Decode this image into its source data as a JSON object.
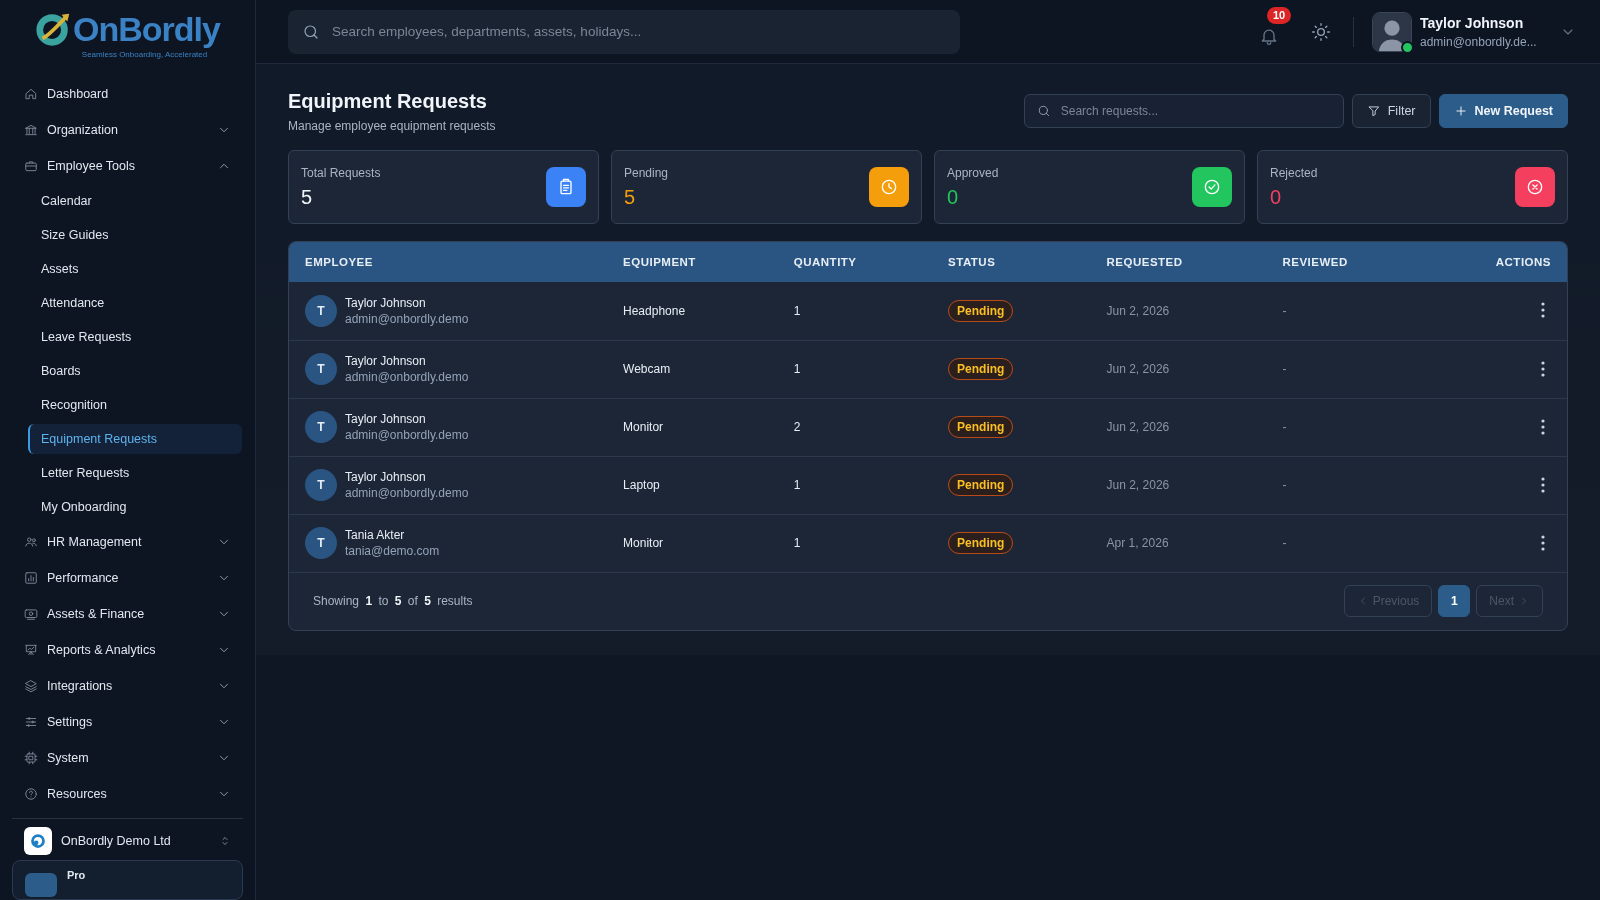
{
  "sidebar": {
    "logo": {
      "name": "OnBordly",
      "tagline": "Seamless Onboarding, Accelerated"
    },
    "items": [
      {
        "label": "Dashboard",
        "kind": "link"
      },
      {
        "label": "Organization",
        "kind": "group",
        "expanded": false
      },
      {
        "label": "Employee Tools",
        "kind": "group",
        "expanded": true,
        "children": [
          {
            "label": "Calendar",
            "selected": false
          },
          {
            "label": "Size Guides",
            "selected": false
          },
          {
            "label": "Assets",
            "selected": false
          },
          {
            "label": "Attendance",
            "selected": false
          },
          {
            "label": "Leave Requests",
            "selected": false
          },
          {
            "label": "Boards",
            "selected": false
          },
          {
            "label": "Recognition",
            "selected": false
          },
          {
            "label": "Equipment Requests",
            "selected": true
          },
          {
            "label": "Letter Requests",
            "selected": false
          },
          {
            "label": "My Onboarding",
            "selected": false
          }
        ]
      },
      {
        "label": "HR Management",
        "kind": "group",
        "expanded": false
      },
      {
        "label": "Performance",
        "kind": "group",
        "expanded": false
      },
      {
        "label": "Assets & Finance",
        "kind": "group",
        "expanded": false
      },
      {
        "label": "Reports & Analytics",
        "kind": "group",
        "expanded": false
      },
      {
        "label": "Integrations",
        "kind": "group",
        "expanded": false
      },
      {
        "label": "Settings",
        "kind": "group",
        "expanded": false
      },
      {
        "label": "System",
        "kind": "group",
        "expanded": false
      },
      {
        "label": "Resources",
        "kind": "group",
        "expanded": false
      }
    ],
    "workspace": {
      "name": "OnBordly Demo Ltd"
    },
    "plan": {
      "label": "Pro"
    }
  },
  "topbar": {
    "search": {
      "placeholder": "Search employees, departments, assets, holidays..."
    },
    "notifications": {
      "count": "10"
    },
    "user": {
      "name": "Taylor Johnson",
      "email": "admin@onbordly.de...",
      "online": true
    }
  },
  "page": {
    "title": "Equipment Requests",
    "subtitle": "Manage employee equipment requests",
    "search": {
      "placeholder": "Search requests..."
    },
    "buttons": [
      {
        "label": "Filter",
        "kind": "filter"
      },
      {
        "label": "New Request",
        "kind": "primary"
      }
    ],
    "stats": [
      {
        "label": "Total Requests",
        "value": "5",
        "kind": "clipboard",
        "color": "#3b82f6"
      },
      {
        "label": "Pending",
        "value": "5",
        "kind": "clock",
        "color": "#f59e0b"
      },
      {
        "label": "Approved",
        "value": "0",
        "kind": "check",
        "color": "#22c55e"
      },
      {
        "label": "Rejected",
        "value": "0",
        "kind": "cross",
        "color": "#f43f5e"
      }
    ],
    "table": {
      "columns": [
        "EMPLOYEE",
        "EQUIPMENT",
        "QUANTITY",
        "STATUS",
        "REQUESTED",
        "REVIEWED",
        "ACTIONS"
      ],
      "rows": [
        {
          "initial": "T",
          "name": "Taylor Johnson",
          "email": "admin@onbordly.demo",
          "equipment": "Headphone",
          "quantity": "1",
          "status": "Pending",
          "requested": "Jun 2, 2026",
          "reviewed": "-"
        },
        {
          "initial": "T",
          "name": "Taylor Johnson",
          "email": "admin@onbordly.demo",
          "equipment": "Webcam",
          "quantity": "1",
          "status": "Pending",
          "requested": "Jun 2, 2026",
          "reviewed": "-"
        },
        {
          "initial": "T",
          "name": "Taylor Johnson",
          "email": "admin@onbordly.demo",
          "equipment": "Monitor",
          "quantity": "2",
          "status": "Pending",
          "requested": "Jun 2, 2026",
          "reviewed": "-"
        },
        {
          "initial": "T",
          "name": "Taylor Johnson",
          "email": "admin@onbordly.demo",
          "equipment": "Laptop",
          "quantity": "1",
          "status": "Pending",
          "requested": "Jun 2, 2026",
          "reviewed": "-"
        },
        {
          "initial": "T",
          "name": "Tania Akter",
          "email": "tania@demo.com",
          "equipment": "Monitor",
          "quantity": "1",
          "status": "Pending",
          "requested": "Apr 1, 2026",
          "reviewed": "-"
        }
      ],
      "summary": "Showing **1** to **5** of **5** results",
      "pagination": {
        "previous": {
          "label": "Previous",
          "disabled": true
        },
        "pages": [
          {
            "label": "1",
            "selected": true
          }
        ],
        "next": {
          "label": "Next",
          "disabled": true
        }
      }
    }
  }
}
